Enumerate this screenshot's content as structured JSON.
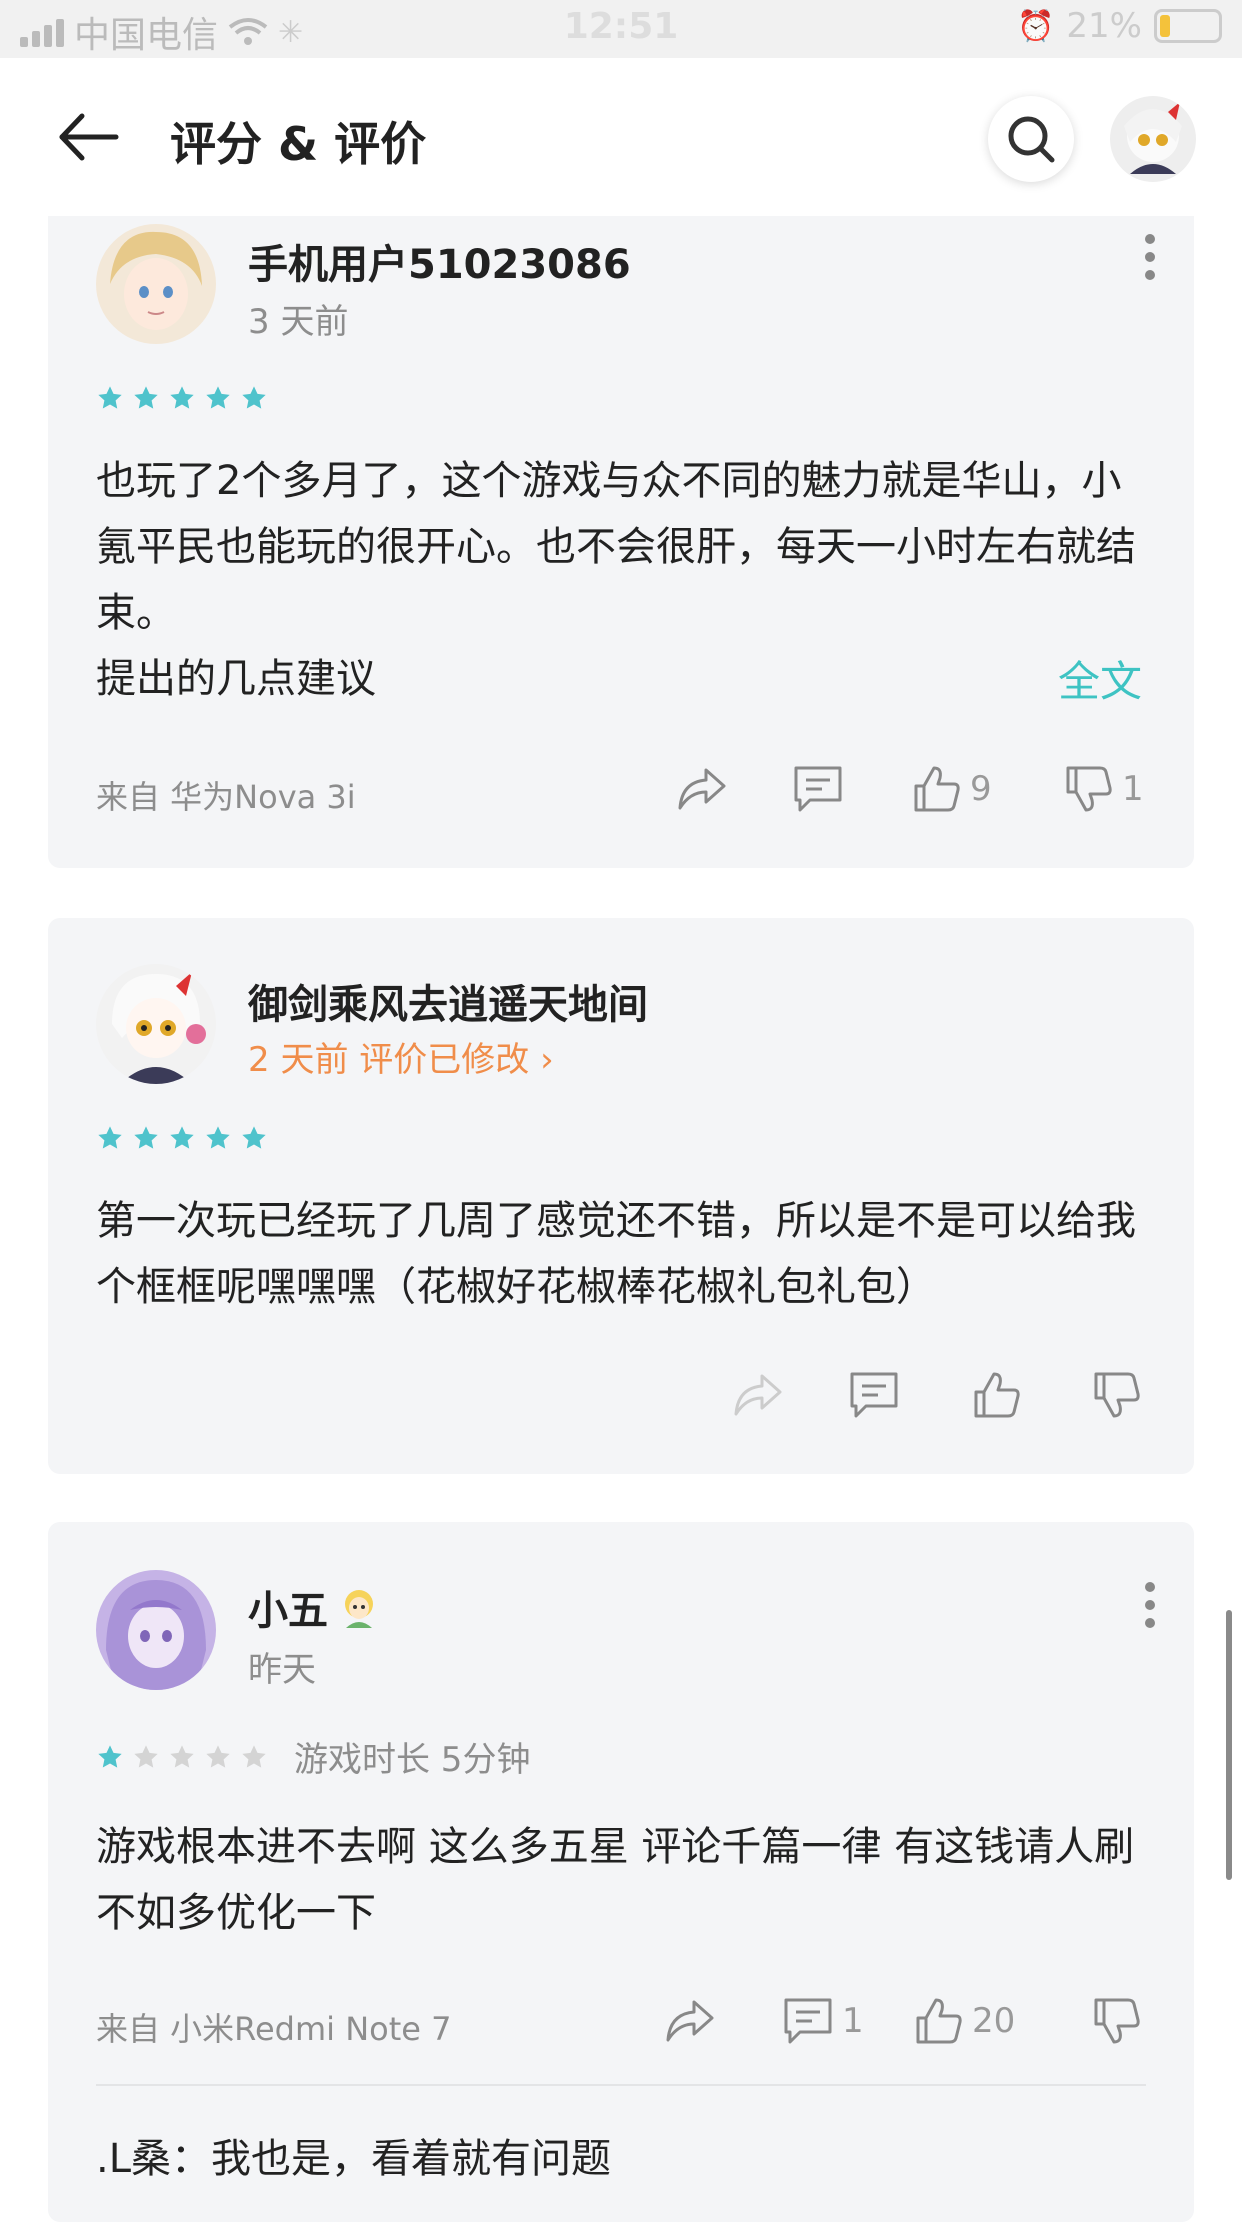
{
  "status_bar": {
    "carrier": "中国电信",
    "time": "12:51",
    "battery": "21%"
  },
  "header": {
    "title": "评分 & 评价"
  },
  "reviews": [
    {
      "user": "手机用户51023086",
      "time": "3 天前",
      "rating": 5,
      "body": "也玩了2个多月了，这个游戏与众不同的魅力就是华山，小氪平民也能玩的很开心。也不会很肝，每天一小时左右就结束。\n提出的几点建议",
      "full_text_label": "全文",
      "device": "来自 华为Nova 3i",
      "likes": "9",
      "dislikes": "1"
    },
    {
      "user": "御剑乘风去逍遥天地间",
      "time": "2 天前 评价已修改",
      "rating": 5,
      "body": "第一次玩已经玩了几周了感觉还不错，所以是不是可以给我个框框呢嘿嘿嘿（花椒好花椒棒花椒礼包礼包）"
    },
    {
      "user": "小五",
      "time": "昨天",
      "rating": 1,
      "play_time": "游戏时长 5分钟",
      "body": "游戏根本进不去啊 这么多五星 评论千篇一律 有这钱请人刷不如多优化一下",
      "device": "来自 小米Redmi Note 7",
      "comments": "1",
      "likes": "20",
      "reply": ".L桑：我也是，看着就有问题"
    }
  ],
  "colors": {
    "accent": "#3ec3c3",
    "star_on": "#4fc3cc",
    "star_off": "#d4d4d4",
    "modified": "#f08d4a"
  }
}
